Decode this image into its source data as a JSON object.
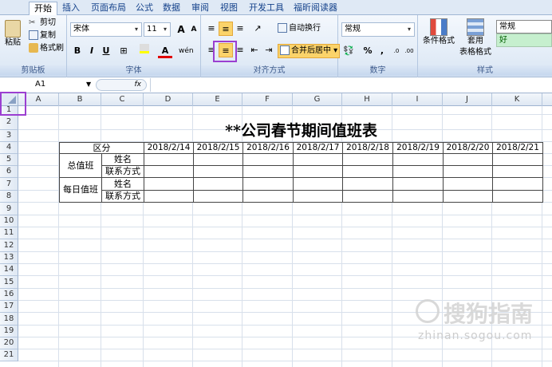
{
  "ribbon": {
    "tabs": [
      "开始",
      "插入",
      "页面布局",
      "公式",
      "数据",
      "审阅",
      "视图",
      "开发工具",
      "福昕阅读器"
    ],
    "clipboard": {
      "paste": "粘贴",
      "cut": "剪切",
      "copy": "复制",
      "format_painter": "格式刷",
      "label": "剪贴板"
    },
    "font": {
      "name": "宋体",
      "size": "11",
      "bold": "B",
      "italic": "I",
      "underline": "U",
      "label": "字体",
      "grow": "A",
      "shrink": "A",
      "phonetic": "wén"
    },
    "alignment": {
      "wrap": "自动换行",
      "merge": "合并后居中",
      "label": "对齐方式"
    },
    "number": {
      "format": "常规",
      "percent": "%",
      "comma": ",",
      "inc_decimal": ".0→.00",
      "dec_decimal": ".00→.0",
      "label": "数字"
    },
    "styles": {
      "conditional": "条件格式",
      "table_format_1": "套用",
      "table_format_2": "表格格式",
      "normal": "常规",
      "good": "好",
      "label": "样式"
    }
  },
  "formula_bar": {
    "name_box": "A1",
    "fx": "fx",
    "value": ""
  },
  "columns": [
    "A",
    "B",
    "C",
    "D",
    "E",
    "F",
    "G",
    "H",
    "I",
    "J",
    "K"
  ],
  "rows": [
    "1",
    "2",
    "3",
    "4",
    "5",
    "6",
    "7",
    "8",
    "9",
    "10",
    "11",
    "12",
    "13",
    "14",
    "15",
    "16",
    "17",
    "18",
    "19",
    "20",
    "21"
  ],
  "sheet": {
    "title": "**公司春节期间值班表",
    "header_label": "区分",
    "dates": [
      "2018/2/14",
      "2018/2/15",
      "2018/2/16",
      "2018/2/17",
      "2018/2/18",
      "2018/2/19",
      "2018/2/20",
      "2018/2/21"
    ],
    "groups": [
      {
        "name": "总值班",
        "fields": [
          "姓名",
          "联系方式"
        ]
      },
      {
        "name": "每日值班",
        "fields": [
          "姓名",
          "联系方式"
        ]
      }
    ]
  },
  "watermark": {
    "brand": "搜狗指南",
    "url": "zhinan.sogou.com"
  },
  "colors": {
    "highlight": "#9b3fd1",
    "ribbon_blue": "#dae6f4",
    "good_fill": "#c6efce"
  }
}
